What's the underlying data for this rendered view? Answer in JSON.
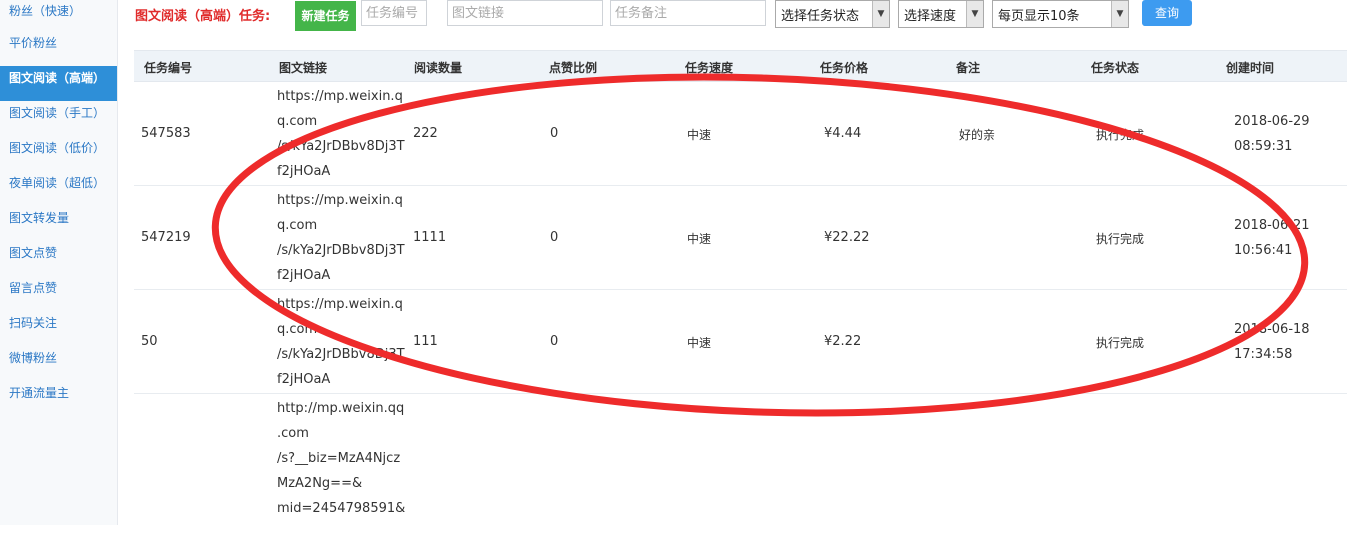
{
  "sidebar": {
    "items": [
      {
        "label": "粉丝（快速）",
        "active": false
      },
      {
        "label": "平价粉丝",
        "active": false
      },
      {
        "label": "图文阅读（高端）",
        "active": true
      },
      {
        "label": "图文阅读（手工）",
        "active": false
      },
      {
        "label": "图文阅读（低价）",
        "active": false
      },
      {
        "label": "夜单阅读（超低）",
        "active": false
      },
      {
        "label": "图文转发量",
        "active": false
      },
      {
        "label": "图文点赞",
        "active": false
      },
      {
        "label": "留言点赞",
        "active": false
      },
      {
        "label": "扫码关注",
        "active": false
      },
      {
        "label": "微博粉丝",
        "active": false
      },
      {
        "label": "开通流量主",
        "active": false
      }
    ]
  },
  "toolbar": {
    "title": "图文阅读（高端）任务:",
    "new_task_label": "新建任务",
    "task_id_placeholder": "任务编号",
    "link_placeholder": "图文链接",
    "remark_placeholder": "任务备注",
    "status_select": "选择任务状态",
    "speed_select": "选择速度",
    "page_size_select": "每页显示10条",
    "query_label": "查询"
  },
  "table": {
    "headers": [
      "任务编号",
      "图文链接",
      "阅读数量",
      "点赞比例",
      "任务速度",
      "任务价格",
      "备注",
      "任务状态",
      "创建时间"
    ],
    "rows": [
      {
        "id": "547583",
        "link": [
          "https://mp.weixin.q",
          "q.com",
          "/s/kYa2JrDBbv8Dj3T",
          "f2jHOaA"
        ],
        "reads": "222",
        "like_ratio": "0",
        "speed": "中速",
        "price": "¥4.44",
        "remark": "好的亲",
        "status": "执行完成",
        "created": [
          "2018-06-29",
          "08:59:31"
        ]
      },
      {
        "id": "547219",
        "link": [
          "https://mp.weixin.q",
          "q.com",
          "/s/kYa2JrDBbv8Dj3T",
          "f2jHOaA"
        ],
        "reads": "1111",
        "like_ratio": "0",
        "speed": "中速",
        "price": "¥22.22",
        "remark": "",
        "status": "执行完成",
        "created": [
          "2018-06-21",
          "10:56:41"
        ]
      },
      {
        "id": "50",
        "link": [
          "https://mp.weixin.q",
          "q.com",
          "/s/kYa2JrDBbv8Dj3T",
          "f2jHOaA"
        ],
        "reads": "111",
        "like_ratio": "0",
        "speed": "中速",
        "price": "¥2.22",
        "remark": "",
        "status": "执行完成",
        "created": [
          "2018-06-18",
          "17:34:58"
        ]
      },
      {
        "id": "",
        "link": [
          "http://mp.weixin.qq",
          ".com",
          "/s?__biz=MzA4Njcz",
          "MzA2Ng==&",
          "mid=2454798591&"
        ],
        "reads": "",
        "like_ratio": "",
        "speed": "",
        "price": "",
        "remark": "",
        "status": "",
        "created": [
          "",
          ""
        ]
      }
    ]
  },
  "colors": {
    "accent_red": "#e02b2b",
    "new_button_green": "#44b549",
    "query_blue": "#3d9bf0",
    "sidebar_active": "#2e8fd8",
    "annotation_red": "#ee2b2b"
  }
}
